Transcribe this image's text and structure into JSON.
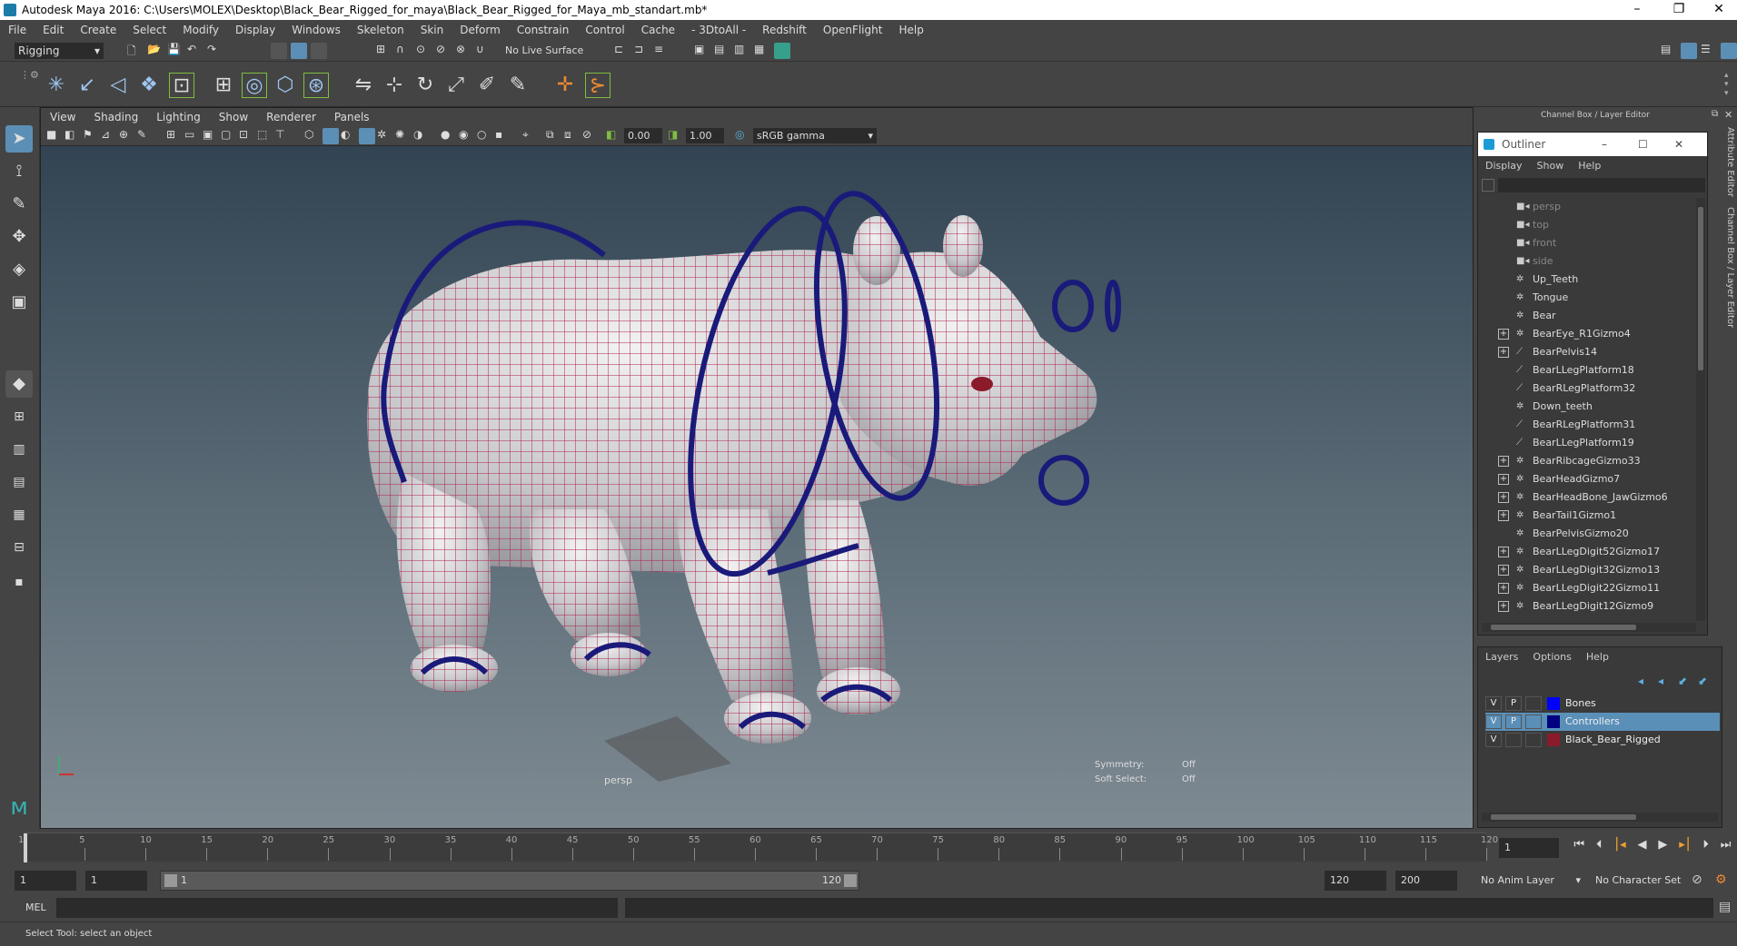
{
  "window": {
    "title": "Autodesk Maya 2016: C:\\Users\\MOLEX\\Desktop\\Black_Bear_Rigged_for_maya\\Black_Bear_Rigged_for_Maya_mb_standart.mb*"
  },
  "menubar": [
    "File",
    "Edit",
    "Create",
    "Select",
    "Modify",
    "Display",
    "Windows",
    "Skeleton",
    "Skin",
    "Deform",
    "Constrain",
    "Control",
    "Cache",
    "- 3DtoAll -",
    "Redshift",
    "OpenFlight",
    "Help"
  ],
  "statusline": {
    "mode": "Rigging",
    "live_surface": "No Live Surface"
  },
  "viewport": {
    "menu": [
      "View",
      "Shading",
      "Lighting",
      "Show",
      "Renderer",
      "Panels"
    ],
    "field_a": "0.00",
    "field_b": "1.00",
    "color_space": "sRGB gamma",
    "camera_label": "persp",
    "symmetry_label": "Symmetry:",
    "symmetry_value": "Off",
    "soft_select_label": "Soft Select:",
    "soft_select_value": "Off"
  },
  "right_panel": {
    "header": "Channel Box / Layer Editor",
    "side_tabs": [
      "Attribute Editor",
      "Channel Box / Layer Editor"
    ]
  },
  "outliner": {
    "title": "Outliner",
    "menu": [
      "Display",
      "Show",
      "Help"
    ],
    "items": [
      {
        "label": "persp",
        "expand": false,
        "dim": true
      },
      {
        "label": "top",
        "expand": false,
        "dim": true
      },
      {
        "label": "front",
        "expand": false,
        "dim": true
      },
      {
        "label": "side",
        "expand": false,
        "dim": true
      },
      {
        "label": "Up_Teeth",
        "expand": false,
        "dim": false
      },
      {
        "label": "Tongue",
        "expand": false,
        "dim": false
      },
      {
        "label": "Bear",
        "expand": false,
        "dim": false
      },
      {
        "label": "BearEye_R1Gizmo4",
        "expand": true,
        "dim": false
      },
      {
        "label": "BearPelvis14",
        "expand": true,
        "dim": false
      },
      {
        "label": "BearLLegPlatform18",
        "expand": false,
        "dim": false
      },
      {
        "label": "BearRLegPlatform32",
        "expand": false,
        "dim": false
      },
      {
        "label": "Down_teeth",
        "expand": false,
        "dim": false
      },
      {
        "label": "BearRLegPlatform31",
        "expand": false,
        "dim": false
      },
      {
        "label": "BearLLegPlatform19",
        "expand": false,
        "dim": false
      },
      {
        "label": "BearRibcageGizmo33",
        "expand": true,
        "dim": false
      },
      {
        "label": "BearHeadGizmo7",
        "expand": true,
        "dim": false
      },
      {
        "label": "BearHeadBone_JawGizmo6",
        "expand": true,
        "dim": false
      },
      {
        "label": "BearTail1Gizmo1",
        "expand": true,
        "dim": false
      },
      {
        "label": "BearPelvisGizmo20",
        "expand": false,
        "dim": false
      },
      {
        "label": "BearLLegDigit52Gizmo17",
        "expand": true,
        "dim": false
      },
      {
        "label": "BearLLegDigit32Gizmo13",
        "expand": true,
        "dim": false
      },
      {
        "label": "BearLLegDigit22Gizmo11",
        "expand": true,
        "dim": false
      },
      {
        "label": "BearLLegDigit12Gizmo9",
        "expand": true,
        "dim": false
      }
    ]
  },
  "layers": {
    "menu": [
      "Layers",
      "Options",
      "Help"
    ],
    "rows": [
      {
        "v": "V",
        "p": "P",
        "color": "#0000ff",
        "name": "Bones",
        "selected": false
      },
      {
        "v": "V",
        "p": "P",
        "color": "#000080",
        "name": "Controllers",
        "selected": true
      },
      {
        "v": "V",
        "p": "",
        "color": "#8b1a2b",
        "name": "Black_Bear_Rigged",
        "selected": false
      }
    ]
  },
  "timeline": {
    "ticks": [
      "1",
      "5",
      "10",
      "15",
      "20",
      "25",
      "30",
      "35",
      "40",
      "45",
      "50",
      "55",
      "60",
      "65",
      "70",
      "75",
      "80",
      "85",
      "90",
      "95",
      "100",
      "105",
      "110",
      "115",
      "120"
    ],
    "current_frame": "1"
  },
  "range": {
    "start": "1",
    "inner_start": "1",
    "slider_start": "1",
    "slider_end": "120",
    "end": "120",
    "total_end": "200",
    "anim_layer": "No Anim Layer",
    "character_set": "No Character Set"
  },
  "cmdline": {
    "label": "MEL"
  },
  "helpline": {
    "text": "Select Tool: select an object"
  }
}
